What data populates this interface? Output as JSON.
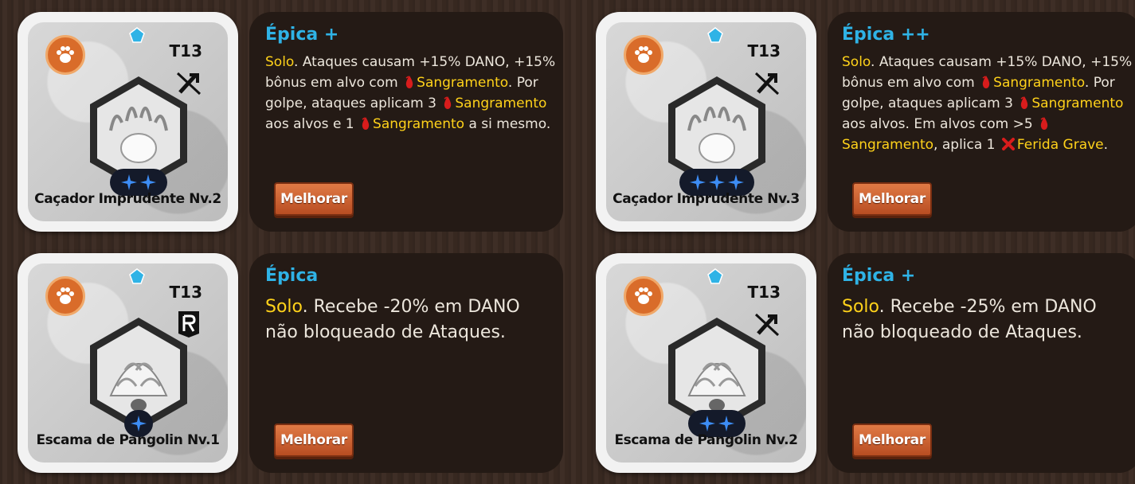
{
  "cards": [
    {
      "name": "Caçador Imprudente Nv.2",
      "tier": "T13",
      "class_icon": "no-magic-icon",
      "art": "paw-icon",
      "stars": 2,
      "rarity": "Épica +",
      "desc_size": "small",
      "description": [
        {
          "t": "Solo",
          "h": true
        },
        {
          "t": ". Ataques causam +15% DANO, +15% bônus em alvo com "
        },
        {
          "i": "bleed-drop-icon"
        },
        {
          "t": "Sangramento",
          "h": true
        },
        {
          "t": ". Por golpe, ataques aplicam 3 "
        },
        {
          "i": "bleed-drop-icon"
        },
        {
          "t": "Sangramento",
          "h": true
        },
        {
          "t": " aos alvos e 1 "
        },
        {
          "i": "bleed-drop-icon"
        },
        {
          "t": "Sangramento",
          "h": true
        },
        {
          "t": " a si mesmo."
        }
      ],
      "button": "Melhorar"
    },
    {
      "name": "Caçador Imprudente Nv.3",
      "tier": "T13",
      "class_icon": "no-magic-icon",
      "art": "paw-icon",
      "stars": 3,
      "rarity": "Épica ++",
      "desc_size": "small",
      "description": [
        {
          "t": "Solo",
          "h": true
        },
        {
          "t": ". Ataques causam +15% DANO, +15% bônus em alvo com "
        },
        {
          "i": "bleed-drop-icon"
        },
        {
          "t": "Sangramento",
          "h": true
        },
        {
          "t": ". Por golpe, ataques aplicam 3 "
        },
        {
          "i": "bleed-drop-icon"
        },
        {
          "t": "Sangramento",
          "h": true
        },
        {
          "t": " aos alvos. Em alvos com >5 "
        },
        {
          "i": "bleed-drop-icon"
        },
        {
          "t": "Sangramento",
          "h": true
        },
        {
          "t": ", aplica 1 "
        },
        {
          "i": "grave-wound-icon"
        },
        {
          "t": "Ferida Grave",
          "h": true
        },
        {
          "t": "."
        }
      ],
      "button": "Melhorar"
    },
    {
      "name": "Escama de Pangolin Nv.1",
      "tier": "T13",
      "class_icon": "ranged-icon",
      "art": "scale-icon",
      "stars": 1,
      "rarity": "Épica",
      "desc_size": "big",
      "description": [
        {
          "t": "Solo",
          "h": true
        },
        {
          "t": ". Recebe -20% em DANO não bloqueado de Ataques."
        }
      ],
      "button": "Melhorar"
    },
    {
      "name": "Escama de Pangolin Nv.2",
      "tier": "T13",
      "class_icon": "no-magic-icon",
      "art": "scale-icon",
      "stars": 2,
      "rarity": "Épica +",
      "desc_size": "big",
      "description": [
        {
          "t": "Solo",
          "h": true
        },
        {
          "t": ". Recebe -25% em DANO não bloqueado de Ataques."
        }
      ],
      "button": "Melhorar"
    }
  ],
  "colors": {
    "rarity": "#2fb3e6",
    "highlight": "#ffd21a",
    "panel": "#241a15",
    "button": "#c95e2e"
  }
}
